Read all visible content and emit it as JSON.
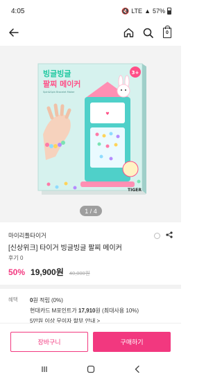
{
  "status_bar": {
    "time": "4:05",
    "network": "LTE",
    "battery": "57%"
  },
  "header": {
    "back_icon": "back-arrow-icon",
    "home_icon": "home-icon",
    "search_icon": "search-icon",
    "cart_icon": "cart-icon",
    "cart_count": "0"
  },
  "gallery": {
    "page_indicator": "1 / 4",
    "box_title_line1": "빙글빙글",
    "box_title_line2": "팔찌 메이커",
    "box_subtitle": "Spin&Spin Bracelet Maker",
    "age_badge": "3+",
    "brand_logo": "TIGER"
  },
  "product": {
    "brand": "마이리틀타이거",
    "title": "[신상위크] 타이거 빙글빙글 팔찌 메이커",
    "review": "후기 0",
    "discount": "50%",
    "price": "19,900원",
    "original_price": "40,000원"
  },
  "benefits": {
    "label": "혜택",
    "line1_bold": "0",
    "line1_rest": "원 적립 (0%)",
    "line2_pre": "현대카드 M포인트가 ",
    "line2_bold": "17,910",
    "line2_post": "원 (최대사용 10%)",
    "line3": "5만원 이상 무이자 할부 안내 >"
  },
  "actions": {
    "cart_label": "장바구니",
    "buy_label": "구매하기"
  },
  "colors": {
    "accent": "#f2387f",
    "box_teal": "#3cc9c3",
    "box_title_green": "#1ec8a0",
    "box_title_pink": "#ff4f87"
  }
}
